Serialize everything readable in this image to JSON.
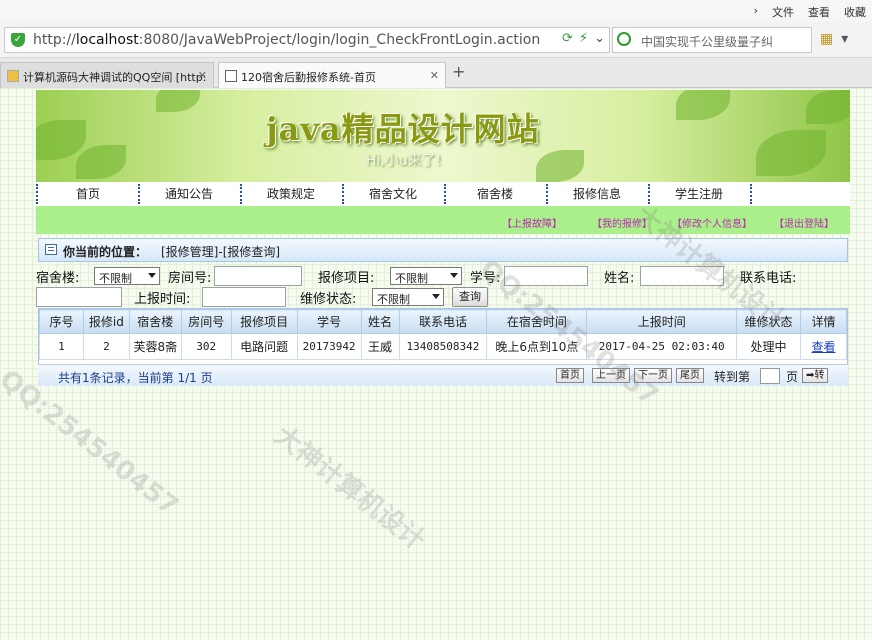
{
  "browser": {
    "menu": [
      "文件",
      "查看",
      "收藏"
    ],
    "url_prefix": "http://",
    "url_host": "localhost",
    "url_rest": ":8080/JavaWebProject/login/login_CheckFrontLogin.action",
    "search_placeholder": "中国实现千公里级量子纠",
    "tabs": [
      {
        "label": "计算机源码大神调试的QQ空间 [http:"
      },
      {
        "label": "120宿舍后勤报修系统-首页"
      }
    ],
    "new_tab": "+"
  },
  "site": {
    "title": "java精品设计网站",
    "greeting": "Hi,小u来了!"
  },
  "nav": [
    "首页",
    "通知公告",
    "政策规定",
    "宿舍文化",
    "宿舍楼",
    "报修信息",
    "学生注册"
  ],
  "user_links": [
    "【上报故障】",
    "【我的报修】",
    "【修改个人信息】",
    "【退出登陆】"
  ],
  "position": {
    "label": "你当前的位置：",
    "path": "[报修管理]-[报修查询]"
  },
  "filters": {
    "dorm_building_label": "宿舍楼:",
    "dorm_building_value": "不限制",
    "room_label": "房间号:",
    "item_label": "报修项目:",
    "item_value": "不限制",
    "student_no_label": "学号:",
    "name_label": "姓名:",
    "phone_label": "联系电话:",
    "time_label": "上报时间:",
    "status_label": "维修状态:",
    "status_value": "不限制",
    "query_button": "查询"
  },
  "table": {
    "headers": [
      "序号",
      "报修id",
      "宿舍楼",
      "房间号",
      "报修项目",
      "学号",
      "姓名",
      "联系电话",
      "在宿舍时间",
      "上报时间",
      "维修状态",
      "详情"
    ],
    "rows": [
      [
        "1",
        "2",
        "芙蓉8斋",
        "302",
        "电路问题",
        "20173942",
        "王威",
        "13408508342",
        "晚上6点到10点",
        "2017-04-25 02:03:40",
        "处理中",
        "查看"
      ]
    ]
  },
  "pager": {
    "summary": "共有1条记录，当前第 1/1 页",
    "first": "首页",
    "prev": "上一页",
    "next": "下一页",
    "last": "尾页",
    "jump_label": "转到第",
    "page_unit": "页",
    "go": "➡转"
  }
}
